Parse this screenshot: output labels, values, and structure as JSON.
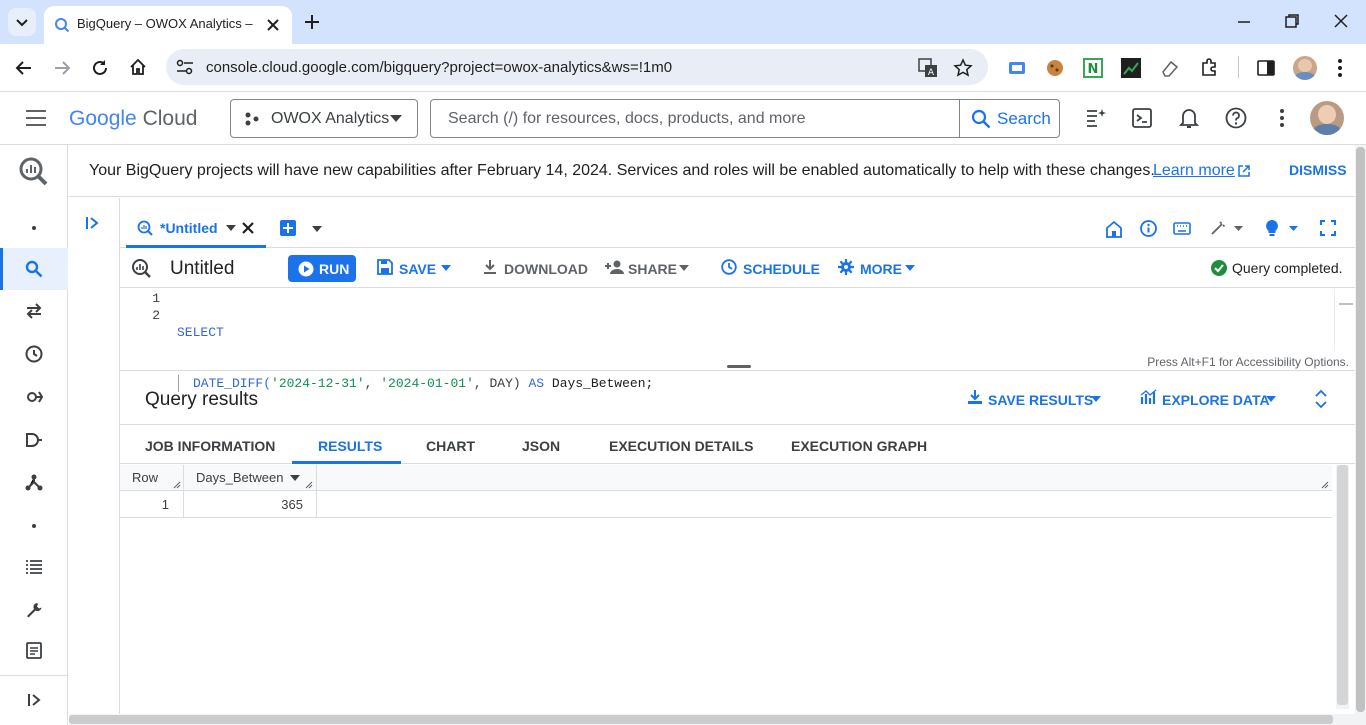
{
  "browser": {
    "tab_title": "BigQuery – OWOX Analytics – G",
    "url": "console.cloud.google.com/bigquery?project=owox-analytics&ws=!1m0"
  },
  "header": {
    "logo_google": "Google",
    "logo_cloud": "Cloud",
    "project": "OWOX Analytics",
    "search_placeholder": "Search (/) for resources, docs, products, and more",
    "search_button": "Search"
  },
  "banner": {
    "text": "Your BigQuery projects will have new capabilities after February 14, 2024. Services and roles will be enabled automatically to help with these changes.",
    "link": "Learn more",
    "dismiss": "DISMISS"
  },
  "editor_tab": {
    "label": "*Untitled"
  },
  "toolbar": {
    "title": "Untitled",
    "run": "RUN",
    "save": "SAVE",
    "download": "DOWNLOAD",
    "share": "SHARE",
    "schedule": "SCHEDULE",
    "more": "MORE",
    "status": "Query completed."
  },
  "editor": {
    "line_numbers": [
      "1",
      "2"
    ],
    "line1": "SELECT",
    "line2_fn": "DATE_DIFF(",
    "line2_arg1": "'2024-12-31'",
    "line2_sep1": ", ",
    "line2_arg2": "'2024-01-01'",
    "line2_sep2": ", DAY) ",
    "line2_as": "AS",
    "line2_alias": " Days_Between;",
    "accessibility_hint": "Press Alt+F1 for Accessibility Options."
  },
  "results": {
    "title": "Query results",
    "save_results": "SAVE RESULTS",
    "explore_data": "EXPLORE DATA",
    "tabs": [
      "JOB INFORMATION",
      "RESULTS",
      "CHART",
      "JSON",
      "EXECUTION DETAILS",
      "EXECUTION GRAPH"
    ],
    "columns": [
      "Row",
      "Days_Between"
    ],
    "rows": [
      [
        "1",
        "365"
      ]
    ]
  },
  "colors": {
    "accent": "#1a73e8",
    "success": "#1e8e3e",
    "chrome_tabstrip": "#d3e3fd"
  }
}
